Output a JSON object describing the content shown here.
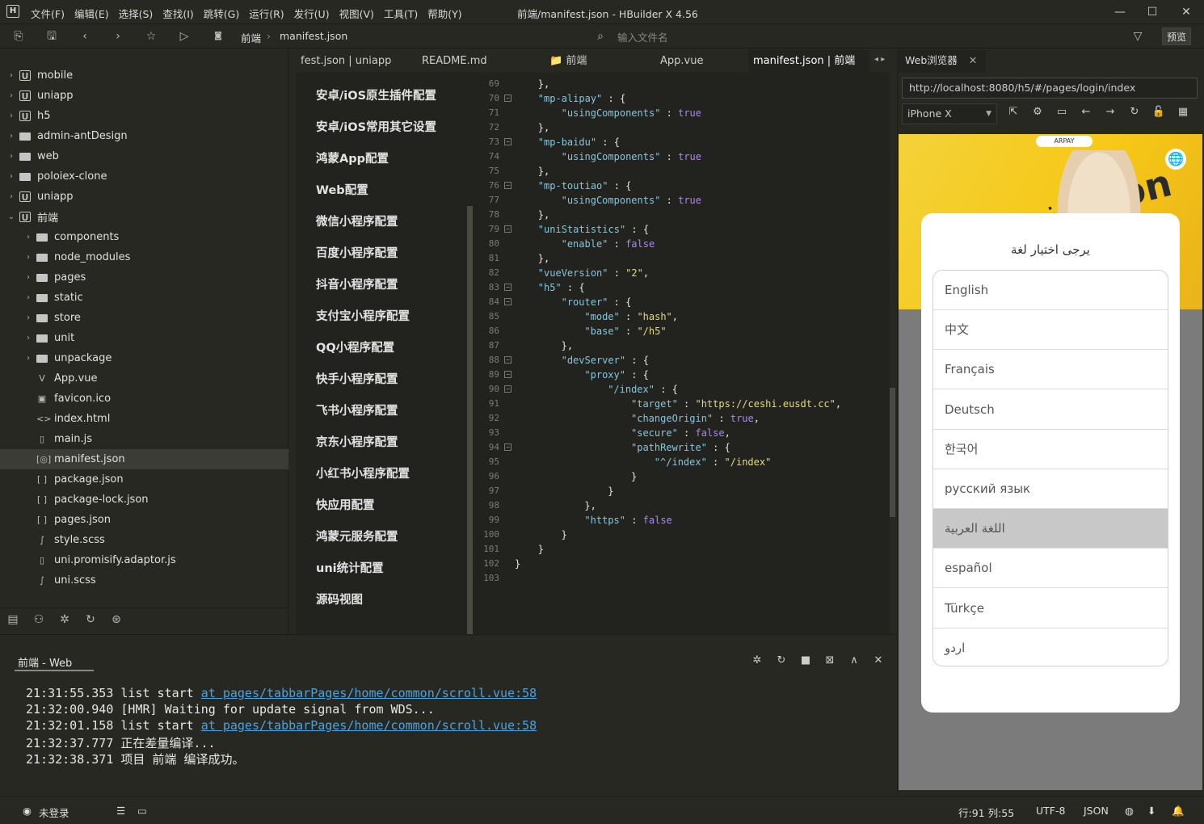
{
  "window": {
    "title": "前端/manifest.json - HBuilder X 4.56",
    "logo": "H"
  },
  "menu": [
    "文件(F)",
    "编辑(E)",
    "选择(S)",
    "查找(I)",
    "跳转(G)",
    "运行(R)",
    "发行(U)",
    "视图(V)",
    "工具(T)",
    "帮助(Y)"
  ],
  "toolbar": {
    "crumbs": [
      "前端",
      "manifest.json"
    ],
    "filter_placeholder": "输入文件名",
    "preview": "预览"
  },
  "sidebar": {
    "items": [
      {
        "label": "mobile",
        "type": "project",
        "level": 0,
        "arrow": "›"
      },
      {
        "label": "uniapp",
        "type": "project",
        "level": 0,
        "arrow": "›"
      },
      {
        "label": "h5",
        "type": "project",
        "level": 0,
        "arrow": "›"
      },
      {
        "label": "admin-antDesign",
        "type": "folder",
        "level": 0,
        "arrow": "›"
      },
      {
        "label": "web",
        "type": "folder",
        "level": 0,
        "arrow": "›"
      },
      {
        "label": "poloiex-clone",
        "type": "folder",
        "level": 0,
        "arrow": "›"
      },
      {
        "label": "uniapp",
        "type": "project",
        "level": 0,
        "arrow": "›"
      },
      {
        "label": "前端",
        "type": "project",
        "level": 0,
        "arrow": "⌄"
      },
      {
        "label": "components",
        "type": "folder",
        "level": 1,
        "arrow": "›"
      },
      {
        "label": "node_modules",
        "type": "folder",
        "level": 1,
        "arrow": "›"
      },
      {
        "label": "pages",
        "type": "folder",
        "level": 1,
        "arrow": "›"
      },
      {
        "label": "static",
        "type": "folder",
        "level": 1,
        "arrow": "›"
      },
      {
        "label": "store",
        "type": "folder",
        "level": 1,
        "arrow": "›"
      },
      {
        "label": "unit",
        "type": "folder",
        "level": 1,
        "arrow": "›"
      },
      {
        "label": "unpackage",
        "type": "folder",
        "level": 1,
        "arrow": "›"
      },
      {
        "label": "App.vue",
        "type": "file",
        "level": 1,
        "icon": "V"
      },
      {
        "label": "favicon.ico",
        "type": "file",
        "level": 1,
        "icon": "▣"
      },
      {
        "label": "index.html",
        "type": "file",
        "level": 1,
        "icon": "<>"
      },
      {
        "label": "main.js",
        "type": "file",
        "level": 1,
        "icon": "▯"
      },
      {
        "label": "manifest.json",
        "type": "file",
        "level": 1,
        "icon": "[◎]",
        "selected": true
      },
      {
        "label": "package.json",
        "type": "file",
        "level": 1,
        "icon": "[ ]"
      },
      {
        "label": "package-lock.json",
        "type": "file",
        "level": 1,
        "icon": "[ ]"
      },
      {
        "label": "pages.json",
        "type": "file",
        "level": 1,
        "icon": "[ ]"
      },
      {
        "label": "style.scss",
        "type": "file",
        "level": 1,
        "icon": "∫"
      },
      {
        "label": "uni.promisify.adaptor.js",
        "type": "file",
        "level": 1,
        "icon": "▯"
      },
      {
        "label": "uni.scss",
        "type": "file",
        "level": 1,
        "icon": "∫"
      }
    ]
  },
  "tabs": [
    {
      "label": "fest.json | uniapp"
    },
    {
      "label": "README.md"
    },
    {
      "label": "📁 前端"
    },
    {
      "label": "App.vue"
    },
    {
      "label": "manifest.json | 前端",
      "active": true
    }
  ],
  "settings": [
    "安卓/iOS原生插件配置",
    "安卓/iOS常用其它设置",
    "鸿蒙App配置",
    "Web配置",
    "微信小程序配置",
    "百度小程序配置",
    "抖音小程序配置",
    "支付宝小程序配置",
    "QQ小程序配置",
    "快手小程序配置",
    "飞书小程序配置",
    "京东小程序配置",
    "小红书小程序配置",
    "快应用配置",
    "鸿蒙元服务配置",
    "uni统计配置",
    "源码视图"
  ],
  "code": [
    {
      "n": "69",
      "fold": false,
      "indent": 4,
      "parts": [
        [
          "p",
          "},"
        ]
      ]
    },
    {
      "n": "70",
      "fold": true,
      "indent": 4,
      "parts": [
        [
          "k",
          "\"mp-alipay\""
        ],
        [
          "p",
          " : {"
        ]
      ]
    },
    {
      "n": "71",
      "fold": false,
      "indent": 8,
      "parts": [
        [
          "k",
          "\"usingComponents\""
        ],
        [
          "p",
          " : "
        ],
        [
          "b",
          "true"
        ]
      ]
    },
    {
      "n": "72",
      "fold": false,
      "indent": 4,
      "parts": [
        [
          "p",
          "},"
        ]
      ]
    },
    {
      "n": "73",
      "fold": true,
      "indent": 4,
      "parts": [
        [
          "k",
          "\"mp-baidu\""
        ],
        [
          "p",
          " : {"
        ]
      ]
    },
    {
      "n": "74",
      "fold": false,
      "indent": 8,
      "parts": [
        [
          "k",
          "\"usingComponents\""
        ],
        [
          "p",
          " : "
        ],
        [
          "b",
          "true"
        ]
      ]
    },
    {
      "n": "75",
      "fold": false,
      "indent": 4,
      "parts": [
        [
          "p",
          "},"
        ]
      ]
    },
    {
      "n": "76",
      "fold": true,
      "indent": 4,
      "parts": [
        [
          "k",
          "\"mp-toutiao\""
        ],
        [
          "p",
          " : {"
        ]
      ]
    },
    {
      "n": "77",
      "fold": false,
      "indent": 8,
      "parts": [
        [
          "k",
          "\"usingComponents\""
        ],
        [
          "p",
          " : "
        ],
        [
          "b",
          "true"
        ]
      ]
    },
    {
      "n": "78",
      "fold": false,
      "indent": 4,
      "parts": [
        [
          "p",
          "},"
        ]
      ]
    },
    {
      "n": "79",
      "fold": true,
      "indent": 4,
      "parts": [
        [
          "k",
          "\"uniStatistics\""
        ],
        [
          "p",
          " : {"
        ]
      ]
    },
    {
      "n": "80",
      "fold": false,
      "indent": 8,
      "parts": [
        [
          "k",
          "\"enable\""
        ],
        [
          "p",
          " : "
        ],
        [
          "b",
          "false"
        ]
      ]
    },
    {
      "n": "81",
      "fold": false,
      "indent": 4,
      "parts": [
        [
          "p",
          "},"
        ]
      ]
    },
    {
      "n": "82",
      "fold": false,
      "indent": 4,
      "parts": [
        [
          "k",
          "\"vueVersion\""
        ],
        [
          "p",
          " : "
        ],
        [
          "s",
          "\"2\""
        ],
        [
          "p",
          ","
        ]
      ]
    },
    {
      "n": "83",
      "fold": true,
      "indent": 4,
      "parts": [
        [
          "k",
          "\"h5\""
        ],
        [
          "p",
          " : {"
        ]
      ]
    },
    {
      "n": "84",
      "fold": true,
      "indent": 8,
      "parts": [
        [
          "k",
          "\"router\""
        ],
        [
          "p",
          " : {"
        ]
      ]
    },
    {
      "n": "85",
      "fold": false,
      "indent": 12,
      "parts": [
        [
          "k",
          "\"mode\""
        ],
        [
          "p",
          " : "
        ],
        [
          "s",
          "\"hash\""
        ],
        [
          "p",
          ","
        ]
      ]
    },
    {
      "n": "86",
      "fold": false,
      "indent": 12,
      "parts": [
        [
          "k",
          "\"base\""
        ],
        [
          "p",
          " : "
        ],
        [
          "s",
          "\"/h5\""
        ]
      ]
    },
    {
      "n": "87",
      "fold": false,
      "indent": 8,
      "parts": [
        [
          "p",
          "},"
        ]
      ]
    },
    {
      "n": "88",
      "fold": true,
      "indent": 8,
      "parts": [
        [
          "k",
          "\"devServer\""
        ],
        [
          "p",
          " : {"
        ]
      ]
    },
    {
      "n": "89",
      "fold": true,
      "indent": 12,
      "parts": [
        [
          "k",
          "\"proxy\""
        ],
        [
          "p",
          " : {"
        ]
      ]
    },
    {
      "n": "90",
      "fold": true,
      "indent": 16,
      "parts": [
        [
          "k",
          "\"/index\""
        ],
        [
          "p",
          " : {"
        ]
      ]
    },
    {
      "n": "91",
      "fold": false,
      "indent": 20,
      "parts": [
        [
          "k",
          "\"target\""
        ],
        [
          "p",
          " : "
        ],
        [
          "s",
          "\"https://ceshi.eusdt.cc\""
        ],
        [
          "p",
          ","
        ]
      ]
    },
    {
      "n": "92",
      "fold": false,
      "indent": 20,
      "parts": [
        [
          "k",
          "\"changeOrigin\""
        ],
        [
          "p",
          " : "
        ],
        [
          "b",
          "true"
        ],
        [
          "p",
          ","
        ]
      ]
    },
    {
      "n": "93",
      "fold": false,
      "indent": 20,
      "parts": [
        [
          "k",
          "\"secure\""
        ],
        [
          "p",
          " : "
        ],
        [
          "b",
          "false"
        ],
        [
          "p",
          ","
        ]
      ]
    },
    {
      "n": "94",
      "fold": true,
      "indent": 20,
      "parts": [
        [
          "k",
          "\"pathRewrite\""
        ],
        [
          "p",
          " : {"
        ]
      ]
    },
    {
      "n": "95",
      "fold": false,
      "indent": 24,
      "parts": [
        [
          "k",
          "\"^/index\""
        ],
        [
          "p",
          " : "
        ],
        [
          "s",
          "\"/index\""
        ]
      ]
    },
    {
      "n": "96",
      "fold": false,
      "indent": 20,
      "parts": [
        [
          "p",
          "}"
        ]
      ]
    },
    {
      "n": "97",
      "fold": false,
      "indent": 16,
      "parts": [
        [
          "p",
          "}"
        ]
      ]
    },
    {
      "n": "98",
      "fold": false,
      "indent": 12,
      "parts": [
        [
          "p",
          "},"
        ]
      ]
    },
    {
      "n": "99",
      "fold": false,
      "indent": 12,
      "parts": [
        [
          "k",
          "\"https\""
        ],
        [
          "p",
          " : "
        ],
        [
          "b",
          "false"
        ]
      ]
    },
    {
      "n": "100",
      "fold": false,
      "indent": 8,
      "parts": [
        [
          "p",
          "}"
        ]
      ]
    },
    {
      "n": "101",
      "fold": false,
      "indent": 4,
      "parts": [
        [
          "p",
          "}"
        ]
      ]
    },
    {
      "n": "102",
      "fold": false,
      "indent": 0,
      "parts": [
        [
          "p",
          "}"
        ]
      ]
    },
    {
      "n": "103",
      "fold": false,
      "indent": 0,
      "parts": []
    }
  ],
  "browser": {
    "tab": "Web浏览器",
    "url": "http://localhost:8080/h5/#/pages/login/index",
    "device": "iPhone X",
    "banner_brand": "ARPAY",
    "banner_text": "نون noon"
  },
  "modal": {
    "title": "يرجى اختيار لغة",
    "languages": [
      "English",
      "中文",
      "Français",
      "Deutsch",
      "한국어",
      "русский язык",
      "اللغة العربية",
      "español",
      "Türkçe",
      "اردو"
    ],
    "selected_index": 6
  },
  "output": {
    "title": "前端 - Web",
    "logs": [
      {
        "time": "21:31:55.353",
        "text": "list start ",
        "link": "at pages/tabbarPages/home/common/scroll.vue:58"
      },
      {
        "time": "21:32:00.940",
        "text": "[HMR] Waiting for update signal from WDS...",
        "link": ""
      },
      {
        "time": "21:32:01.158",
        "text": "list start ",
        "link": "at pages/tabbarPages/home/common/scroll.vue:58"
      },
      {
        "time": "21:32:37.777",
        "text": "正在差量编译...",
        "link": ""
      },
      {
        "time": "21:32:38.371",
        "text": "项目 前端 编译成功。",
        "link": ""
      }
    ]
  },
  "status": {
    "login": "未登录",
    "position": "行:91  列:55",
    "encoding": "UTF-8",
    "lang": "JSON"
  },
  "colors": {
    "bg": "#272822",
    "editor": "#22231f",
    "key": "#7ec8e3",
    "string": "#e6db74",
    "bool": "#ae81ff",
    "link": "#4aa3df"
  }
}
